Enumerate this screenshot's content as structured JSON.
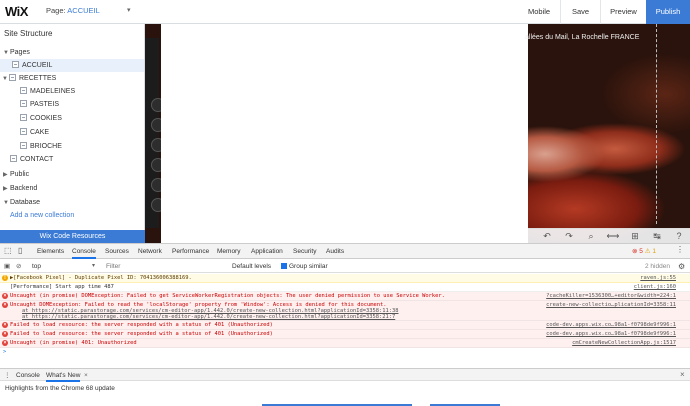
{
  "topbar": {
    "logo": "WiX",
    "page_label": "Page:",
    "page_value": "ACCUEIL",
    "mobile": "Mobile",
    "save": "Save",
    "preview": "Preview",
    "publish": "Publish"
  },
  "panel": {
    "title": "Site Structure",
    "pages_label": "Pages",
    "items": [
      "ACCUEIL",
      "RECETTES",
      "MADELEINES",
      "PASTEIS",
      "COOKIES",
      "CAKE",
      "BRIOCHE",
      "CONTACT"
    ],
    "sections": [
      "Public",
      "Backend",
      "Database"
    ],
    "add_collection": "Add a new collection",
    "code_resources": "Wix Code Resources"
  },
  "stage": {
    "address": "allées du Mail, La Rochelle  FRANCE"
  },
  "devtools": {
    "tabs": [
      "Elements",
      "Console",
      "Sources",
      "Network",
      "Performance",
      "Memory",
      "Application",
      "Security",
      "Audits"
    ],
    "error_count": "5",
    "warn_count": "1",
    "context": "top",
    "filter_placeholder": "Filter",
    "levels": "Default levels",
    "group_similar": "Group similar",
    "hidden": "2 hidden",
    "messages": [
      {
        "level": "warning",
        "text": "▶[Facebook Pixel] - Duplicate Pixel ID: 704136006388169.",
        "source": "raven.js:55"
      },
      {
        "level": "info",
        "text": "[Performance] Start app time 487",
        "source": "client.js:160"
      },
      {
        "level": "error",
        "text": "Uncaught (in promise) DOMException: Failed to get ServiceWorkerRegistration objects: The user denied permission to use Service Worker.",
        "source": "?cacheKiller=1536300…+editor&width=224:1"
      },
      {
        "level": "error",
        "text": "Uncaught DOMException: Failed to read the 'localStorage' property from 'Window': Access is denied for this document.",
        "source": "create-new-collectio…plicationId=3358:11",
        "sub1": "at https://static.parastorage.com/services/cm-editor-app/1.442.0/create-new-collection.html?applicationId=3358:11:38",
        "sub2": "at https://static.parastorage.com/services/cm-editor-app/1.442.0/create-new-collection.html?applicationId=3358:21:7"
      },
      {
        "level": "error",
        "text": "Failed to load resource: the server responded with a status of 401 (Unauthorized)",
        "source": "code-dev.apps.wix.co…98a1-f0798de9f996:1"
      },
      {
        "level": "error",
        "text": "Failed to load resource: the server responded with a status of 401 (Unauthorized)",
        "source": "code-dev.apps.wix.co…98a1-f0798de9f996:1"
      },
      {
        "level": "error",
        "text": "Uncaught (in promise) 401: Unauthorized",
        "source": "cmCreateNewCollectionApp.js:1517"
      }
    ],
    "drawer_tabs": [
      "Console",
      "What's New"
    ],
    "highlights": "Highlights from the Chrome 68 update"
  },
  "colors": {
    "wix_blue": "#3b7bd6",
    "error_red": "#e0413a",
    "warning_amber": "#f2a600"
  }
}
